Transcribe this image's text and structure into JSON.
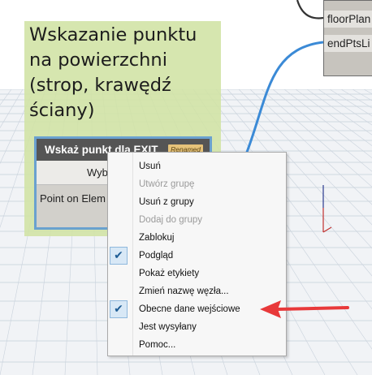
{
  "annotation": {
    "title": "Wskazanie punktu\nna powierzchni\n(strop, krawędź\nściany)"
  },
  "top_node": {
    "ports": [
      "floorPlan",
      "endPtsLi"
    ]
  },
  "selected_node": {
    "title": "Wskaż punkt dla EXIT",
    "badge": "Renamed",
    "button_label": "Wyb",
    "output_label": "Point on Elem"
  },
  "context_menu": {
    "items": [
      {
        "label": "Usuń",
        "enabled": true,
        "checked": false
      },
      {
        "label": "Utwórz grupę",
        "enabled": false,
        "checked": false
      },
      {
        "label": "Usuń z grupy",
        "enabled": true,
        "checked": false
      },
      {
        "label": "Dodaj do grupy",
        "enabled": false,
        "checked": false
      },
      {
        "label": "Zablokuj",
        "enabled": true,
        "checked": false
      },
      {
        "label": "Podgląd",
        "enabled": true,
        "checked": true
      },
      {
        "label": "Pokaż etykiety",
        "enabled": true,
        "checked": false
      },
      {
        "label": "Zmień nazwę węzła...",
        "enabled": true,
        "checked": false
      },
      {
        "label": "Obecne dane wejściowe",
        "enabled": true,
        "checked": true
      },
      {
        "label": "Jest wysyłany",
        "enabled": true,
        "checked": false
      },
      {
        "label": "Pomoc...",
        "enabled": true,
        "checked": false
      }
    ]
  },
  "colors": {
    "accent": "#6aa1cf",
    "annotation": "#d0e2a4",
    "arrow": "#e8393a",
    "wire": "#3b8ad6"
  }
}
